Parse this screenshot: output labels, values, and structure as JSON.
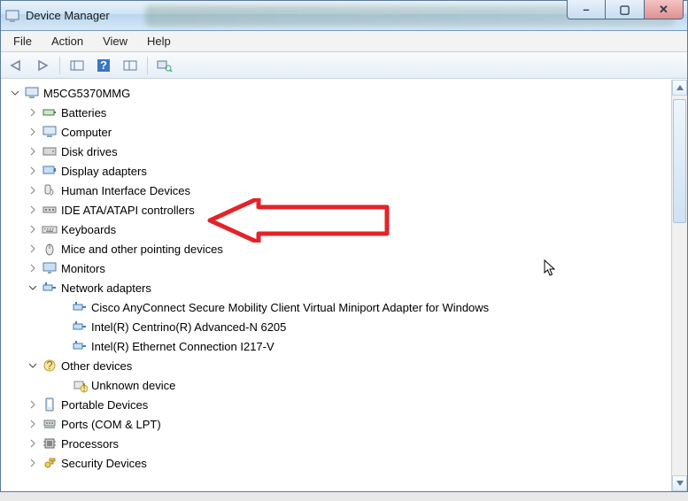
{
  "window": {
    "title": "Device Manager"
  },
  "window_controls": {
    "minimize": "–",
    "maximize": "▢",
    "close": "✕"
  },
  "menu": {
    "file": "File",
    "action": "Action",
    "view": "View",
    "help": "Help"
  },
  "toolbar_icons": {
    "back": "back-nav-icon",
    "forward": "forward-nav-icon",
    "show_hidden": "show-hidden-icon",
    "help": "help-icon",
    "properties": "properties-icon",
    "scan": "scan-hardware-icon"
  },
  "tree": {
    "root": {
      "label": "M5CG5370MMG",
      "expanded": true,
      "icon": "computer-root-icon"
    },
    "nodes": [
      {
        "label": "Batteries",
        "expanded": false,
        "icon": "battery-icon"
      },
      {
        "label": "Computer",
        "expanded": false,
        "icon": "computer-icon"
      },
      {
        "label": "Disk drives",
        "expanded": false,
        "icon": "disk-drive-icon"
      },
      {
        "label": "Display adapters",
        "expanded": false,
        "icon": "display-adapter-icon"
      },
      {
        "label": "Human Interface Devices",
        "expanded": false,
        "icon": "hid-icon"
      },
      {
        "label": "IDE ATA/ATAPI controllers",
        "expanded": false,
        "icon": "ide-controller-icon"
      },
      {
        "label": "Keyboards",
        "expanded": false,
        "icon": "keyboard-icon"
      },
      {
        "label": "Mice and other pointing devices",
        "expanded": false,
        "icon": "mouse-icon"
      },
      {
        "label": "Monitors",
        "expanded": false,
        "icon": "monitor-icon"
      },
      {
        "label": "Network adapters",
        "expanded": true,
        "icon": "network-adapter-icon",
        "children": [
          {
            "label": "Cisco AnyConnect Secure Mobility Client Virtual Miniport Adapter for Windows",
            "icon": "network-adapter-icon"
          },
          {
            "label": "Intel(R) Centrino(R) Advanced-N 6205",
            "icon": "network-adapter-icon"
          },
          {
            "label": "Intel(R) Ethernet Connection I217-V",
            "icon": "network-adapter-icon"
          }
        ]
      },
      {
        "label": "Other devices",
        "expanded": true,
        "icon": "other-devices-icon",
        "children": [
          {
            "label": "Unknown device",
            "icon": "unknown-device-icon"
          }
        ]
      },
      {
        "label": "Portable Devices",
        "expanded": false,
        "icon": "portable-device-icon"
      },
      {
        "label": "Ports (COM & LPT)",
        "expanded": false,
        "icon": "port-icon"
      },
      {
        "label": "Processors",
        "expanded": false,
        "icon": "processor-icon"
      },
      {
        "label": "Security Devices",
        "expanded": false,
        "icon": "security-device-icon"
      }
    ]
  },
  "annotation": {
    "arrow_color": "#e3232a"
  }
}
